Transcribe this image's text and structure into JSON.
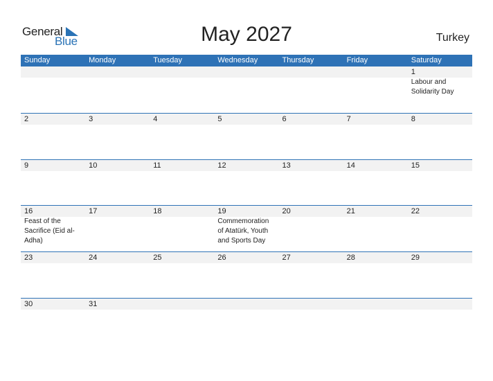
{
  "logo": {
    "general": "General",
    "blue": "Blue"
  },
  "title": "May 2027",
  "country": "Turkey",
  "colors": {
    "accent": "#2e72b6",
    "day_bg": "#f2f2f2"
  },
  "weekdays": [
    "Sunday",
    "Monday",
    "Tuesday",
    "Wednesday",
    "Thursday",
    "Friday",
    "Saturday"
  ],
  "weeks": [
    [
      {
        "d": "",
        "e": ""
      },
      {
        "d": "",
        "e": ""
      },
      {
        "d": "",
        "e": ""
      },
      {
        "d": "",
        "e": ""
      },
      {
        "d": "",
        "e": ""
      },
      {
        "d": "",
        "e": ""
      },
      {
        "d": "1",
        "e": "Labour and Solidarity Day"
      }
    ],
    [
      {
        "d": "2",
        "e": ""
      },
      {
        "d": "3",
        "e": ""
      },
      {
        "d": "4",
        "e": ""
      },
      {
        "d": "5",
        "e": ""
      },
      {
        "d": "6",
        "e": ""
      },
      {
        "d": "7",
        "e": ""
      },
      {
        "d": "8",
        "e": ""
      }
    ],
    [
      {
        "d": "9",
        "e": ""
      },
      {
        "d": "10",
        "e": ""
      },
      {
        "d": "11",
        "e": ""
      },
      {
        "d": "12",
        "e": ""
      },
      {
        "d": "13",
        "e": ""
      },
      {
        "d": "14",
        "e": ""
      },
      {
        "d": "15",
        "e": ""
      }
    ],
    [
      {
        "d": "16",
        "e": "Feast of the Sacrifice (Eid al-Adha)"
      },
      {
        "d": "17",
        "e": ""
      },
      {
        "d": "18",
        "e": ""
      },
      {
        "d": "19",
        "e": "Commemoration of Atatürk, Youth and Sports Day"
      },
      {
        "d": "20",
        "e": ""
      },
      {
        "d": "21",
        "e": ""
      },
      {
        "d": "22",
        "e": ""
      }
    ],
    [
      {
        "d": "23",
        "e": ""
      },
      {
        "d": "24",
        "e": ""
      },
      {
        "d": "25",
        "e": ""
      },
      {
        "d": "26",
        "e": ""
      },
      {
        "d": "27",
        "e": ""
      },
      {
        "d": "28",
        "e": ""
      },
      {
        "d": "29",
        "e": ""
      }
    ],
    [
      {
        "d": "30",
        "e": ""
      },
      {
        "d": "31",
        "e": ""
      },
      {
        "d": "",
        "e": ""
      },
      {
        "d": "",
        "e": ""
      },
      {
        "d": "",
        "e": ""
      },
      {
        "d": "",
        "e": ""
      },
      {
        "d": "",
        "e": ""
      }
    ]
  ]
}
